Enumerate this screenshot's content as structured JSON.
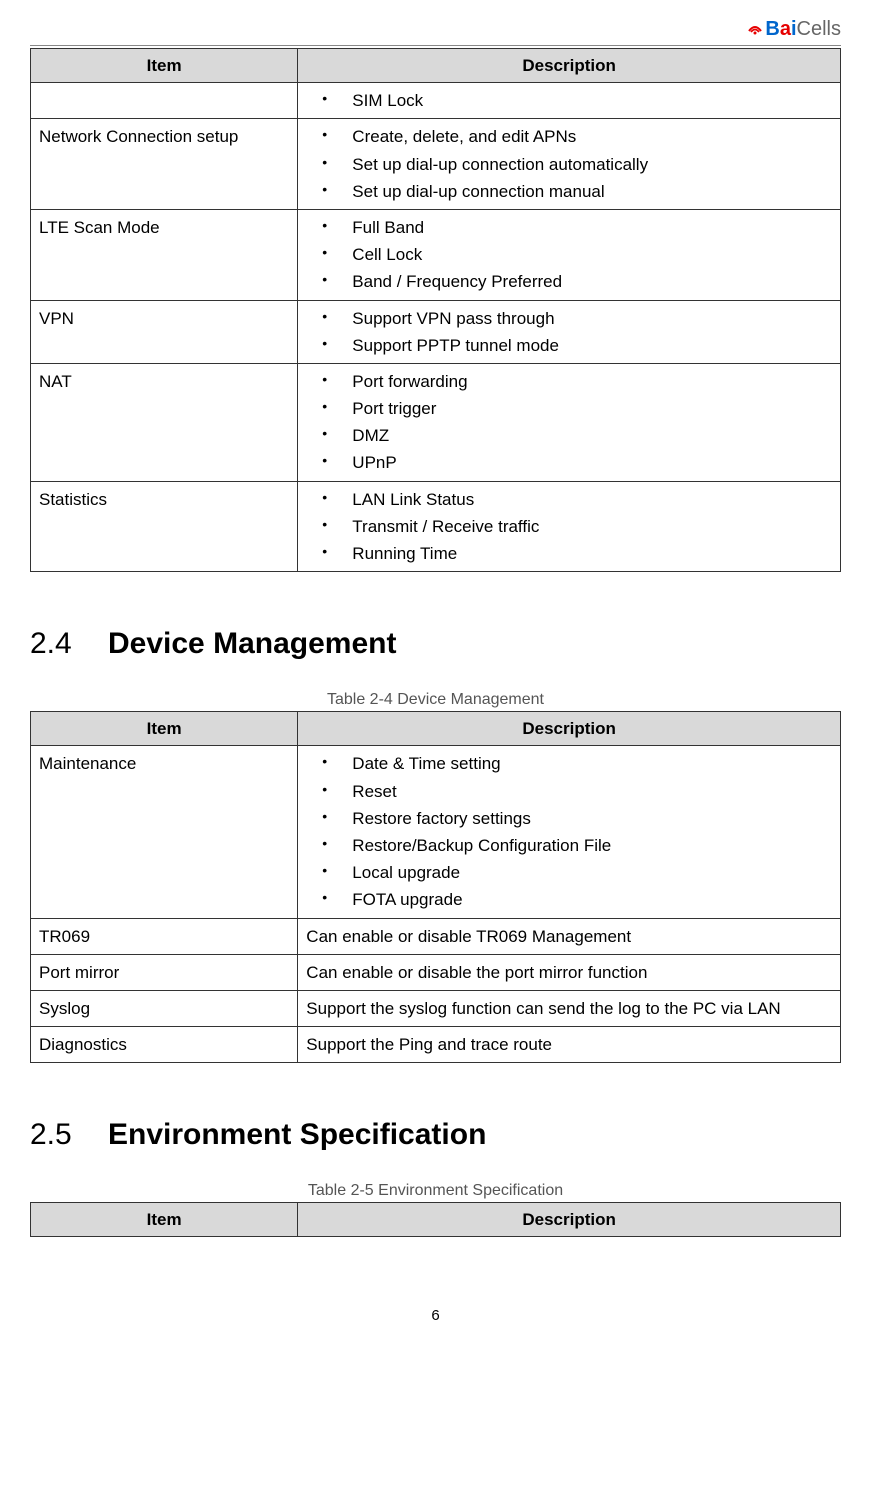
{
  "logo": {
    "brand_b": "B",
    "brand_a": "a",
    "brand_i": "i",
    "brand_cells": "Cells"
  },
  "table1": {
    "header_item": "Item",
    "header_desc": "Description",
    "rows": [
      {
        "item": "",
        "bullets": [
          "SIM Lock"
        ]
      },
      {
        "item": "Network Connection setup",
        "bullets": [
          "Create, delete, and edit APNs",
          "Set up dial-up connection automatically",
          "Set up dial-up connection manual"
        ]
      },
      {
        "item": "LTE Scan Mode",
        "bullets": [
          "Full Band",
          "Cell Lock",
          "Band / Frequency Preferred"
        ]
      },
      {
        "item": "VPN",
        "bullets": [
          "Support VPN pass through",
          "Support PPTP tunnel mode"
        ]
      },
      {
        "item": "NAT",
        "bullets": [
          "Port forwarding",
          "Port trigger",
          "DMZ",
          "UPnP"
        ]
      },
      {
        "item": "Statistics",
        "bullets": [
          "LAN Link Status",
          "Transmit / Receive traffic",
          "Running Time"
        ]
      }
    ]
  },
  "section24": {
    "num": "2.4",
    "title": "Device Management",
    "caption": "Table 2-4 Device Management"
  },
  "table2": {
    "header_item": "Item",
    "header_desc": "Description",
    "rowsA": [
      {
        "item": "Maintenance",
        "bullets": [
          "Date & Time setting",
          "Reset",
          "Restore factory settings",
          "Restore/Backup Configuration File",
          "Local upgrade",
          "FOTA upgrade"
        ]
      }
    ],
    "rowsB": [
      {
        "item": "TR069",
        "text": "Can enable or disable TR069 Management"
      },
      {
        "item": "Port mirror",
        "text": "Can enable or disable the port mirror function"
      },
      {
        "item": "Syslog",
        "text": "Support the syslog function can send the log to the PC via LAN"
      },
      {
        "item": "Diagnostics",
        "text": "Support the Ping and trace route"
      }
    ]
  },
  "section25": {
    "num": "2.5",
    "title": "Environment Specification",
    "caption": "Table 2-5 Environment Specification"
  },
  "table3": {
    "header_item": "Item",
    "header_desc": "Description"
  },
  "page_number": "6"
}
